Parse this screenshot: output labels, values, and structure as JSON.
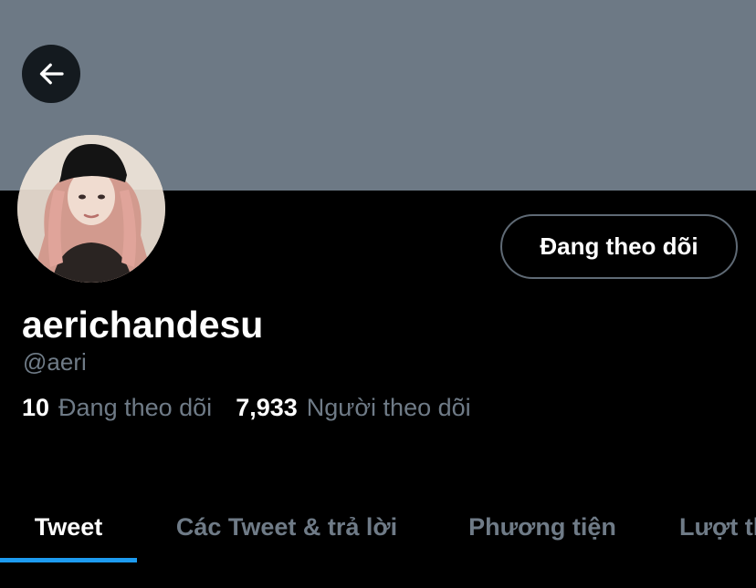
{
  "header": {
    "back_icon": "arrow-left-icon",
    "banner_color": "#6d7985"
  },
  "profile": {
    "display_name": "aerichandesu",
    "handle": "@aeri",
    "follow_button_label": "Đang theo dõi",
    "stats": {
      "following_count": "10",
      "following_label": "Đang theo dõi",
      "followers_count": "7,933",
      "followers_label": "Người theo dõi"
    }
  },
  "tabs": [
    {
      "label": "Tweet",
      "active": true
    },
    {
      "label": "Các Tweet & trả lời",
      "active": false
    },
    {
      "label": "Phương tiện",
      "active": false
    },
    {
      "label": "Lượt thích",
      "active": false
    }
  ],
  "colors": {
    "background": "#000000",
    "accent": "#1d9bf0",
    "secondary_text": "#6f7b87"
  }
}
